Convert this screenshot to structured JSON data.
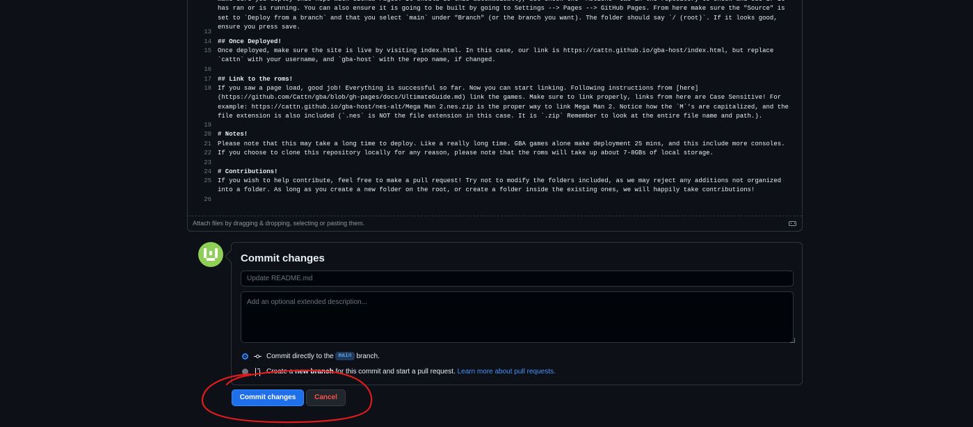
{
  "editor": {
    "lines": [
      {
        "n": "",
        "text": "make sure you deploy this Repo with Github Pages. It should do this automatically, but check the `Actions` tab in the repository to check and see if it has ran or is running. You can also ensure it is going to be built by going to Settings --> Pages --> GitHub Pages. From here make sure the \"Source\" is set to `Deploy from a branch` and that you select `main` under \"Branch\" (or the branch you want). The folder should say `/ (root)`. If it looks good, ensure you press save."
      },
      {
        "n": "13",
        "text": ""
      },
      {
        "n": "14",
        "text": "## Once Deployed!",
        "heading": true
      },
      {
        "n": "15",
        "text": "Once deployed, make sure the site is live by visiting index.html. In this case, our link is https://cattn.github.io/gba-host/index.html, but replace `cattn` with your username, and `gba-host` with the repo name, if changed."
      },
      {
        "n": "16",
        "text": ""
      },
      {
        "n": "17",
        "text": "## Link to the roms!",
        "heading": true
      },
      {
        "n": "18",
        "text": "If you saw a page load, good job! Everything is successful so far. Now you can start linking. Following instructions from [here](https://github.com/Cattn/gba/blob/gh-pages/docs/UltimateGuide.md) link the games. Make sure to link properly, links from here are Case Sensitive! For example: https://cattn.github.io/gba-host/nes-alt/Mega Man 2.nes.zip is the proper way to link Mega Man 2. Notice how the `M`'s are capitalized, and the file extension is also included (`.nes` is NOT the file extension in this case. It is `.zip` Remember to look at the entire file name and path.)."
      },
      {
        "n": "19",
        "text": ""
      },
      {
        "n": "20",
        "text": "# Notes!",
        "heading": true
      },
      {
        "n": "21",
        "text": "Please note that this may take a long time to deploy. Like a really long time. GBA games alone make deployment 25 mins, and this include more consoles."
      },
      {
        "n": "22",
        "text": "If you choose to clone this repository locally for any reason, please note that the roms will take up about 7-8GBs of local storage."
      },
      {
        "n": "23",
        "text": ""
      },
      {
        "n": "24",
        "text": "# Contributions!",
        "heading": true
      },
      {
        "n": "25",
        "text": "If you wish to help contribute, feel free to make a pull request! Try not to modify the folders included, as we may reject any additions not organized into a folder. As long as you create a new folder on the root, or create a folder inside the existing ones, we will happily take contributions!"
      },
      {
        "n": "26",
        "text": ""
      }
    ],
    "attach_hint": "Attach files by dragging & dropping, selecting or pasting them."
  },
  "commit": {
    "title": "Commit changes",
    "summary_placeholder": "Update README.md",
    "description_placeholder": "Add an optional extended description...",
    "option_direct_before": "Commit directly to the",
    "option_direct_branch": "main",
    "option_direct_after": "branch.",
    "option_new_before": "Create a",
    "option_new_bold": "new branch",
    "option_new_after": "for this commit and start a pull request.",
    "option_new_link": "Learn more about pull requests.",
    "commit_button": "Commit changes",
    "cancel_button": "Cancel"
  },
  "colors": {
    "background": "#0d1117",
    "border": "#30363d",
    "primary_button": "#1f6feb",
    "cancel_text": "#f85149",
    "link": "#4493f8",
    "annotation": "#e01b1b",
    "avatar": "#8fcf58"
  },
  "icons": [
    "markdown-icon",
    "git-commit-icon",
    "git-pull-request-icon",
    "avatar"
  ]
}
